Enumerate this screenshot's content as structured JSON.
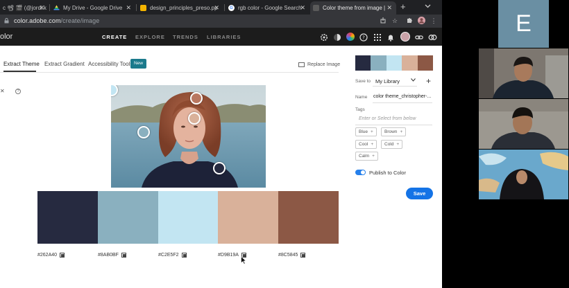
{
  "browser": {
    "tabs": [
      {
        "title": "c 📽 🎬 (@jordi.k",
        "color": "#3a3a3a"
      },
      {
        "title": "My Drive - Google Drive",
        "color": "#1fa463"
      },
      {
        "title": "design_principles_preso.ppt",
        "color": "#f4b400"
      },
      {
        "title": "rgb color - Google Search",
        "color": "#ffffff"
      },
      {
        "title": "Color theme from image | Ad",
        "color": "#3a3a3a"
      }
    ],
    "active_tab": 4,
    "close_glyph": "✕",
    "new_tab_glyph": "+",
    "url_host": "color.adobe.com",
    "url_path": "/create/image"
  },
  "app": {
    "name": "olor",
    "nav": [
      "CREATE",
      "EXPLORE",
      "TRENDS",
      "LIBRARIES"
    ]
  },
  "tool": {
    "subtabs": [
      "Extract Theme",
      "Extract Gradient",
      "Accessibility Tools"
    ],
    "new_badge": "New",
    "replace_image": "Replace Image",
    "help_glyph": "?"
  },
  "palette": {
    "colors": [
      "#262A40",
      "#8AB0BF",
      "#C2E5F2",
      "#D9B19A",
      "#8C5845"
    ],
    "labels": [
      "#262A40",
      "#8AB0BF",
      "#C2E5F2",
      "#D9B19A",
      "#8C5845"
    ]
  },
  "panel": {
    "save_to_label": "Save to",
    "library": "My Library",
    "name_label": "Name",
    "name_value": "color theme_christopher-...",
    "tags_label": "Tags",
    "tags_placeholder": "Enter or Select from below",
    "tags": [
      "Blue",
      "Brown",
      "Cool",
      "Cold",
      "Calm"
    ],
    "publish_label": "Publish to Color",
    "publish_on": true,
    "save_button": "Save"
  },
  "call": {
    "tile_letter": "E",
    "tile_color": "#6a8fa3"
  }
}
